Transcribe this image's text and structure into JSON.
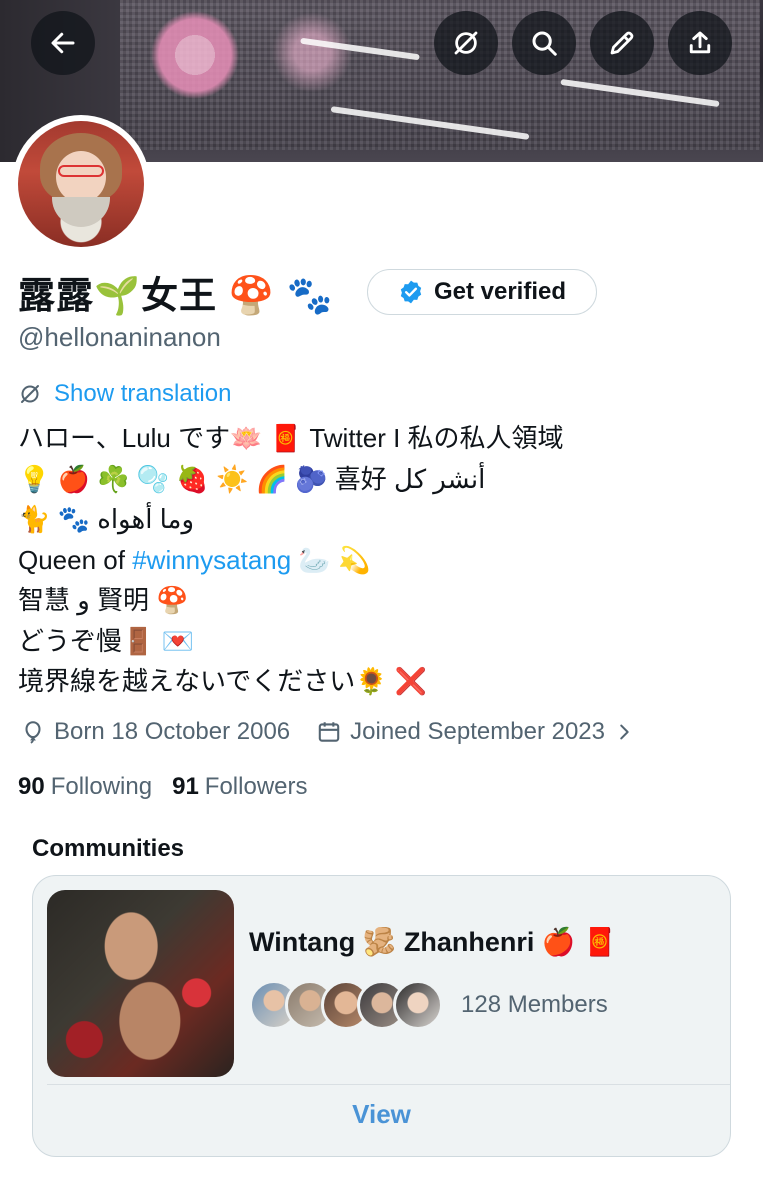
{
  "header": {
    "back_icon": "arrow-left-icon",
    "buttons": [
      "translate-off-icon",
      "search-icon",
      "edit-pencil-icon",
      "share-upload-icon"
    ]
  },
  "profile": {
    "display_name": "露露🌱女王 🍄 🐾",
    "handle": "@hellonaninanon",
    "get_verified_label": "Get verified",
    "show_translation_label": "Show translation",
    "bio_lines": [
      {
        "text": "ハロー、Lulu です🪷 🧧 Twitter I 私の私人領域"
      },
      {
        "text": " 💡 🍎 ☘️ 🫧 🍓 ☀️ 🌈 🫐 喜好 أنشر كل"
      },
      {
        "text": "🐈 🐾 وما أهواه"
      },
      {
        "pre": "Queen of ",
        "tag": "#winnysatang",
        "post": " 🦢 💫"
      },
      {
        "text": "智慧 و 賢明 🍄"
      },
      {
        "text": "どうぞ慢🚪 💌"
      },
      {
        "text": "境界線を越えないでください🌻 ❌"
      }
    ],
    "born": "Born 18 October 2006",
    "joined": "Joined September 2023",
    "following_count": "90",
    "following_label": "Following",
    "followers_count": "91",
    "followers_label": "Followers"
  },
  "communities": {
    "title": "Communities",
    "card": {
      "name": "Wintang 🫚 Zhanhenri 🍎 🧧",
      "members_text": "128 Members",
      "view_label": "View"
    }
  },
  "colors": {
    "accent": "#1d9bf0",
    "secondary_text": "#536471",
    "card_bg": "#eff3f4",
    "border": "#cfd9de"
  }
}
